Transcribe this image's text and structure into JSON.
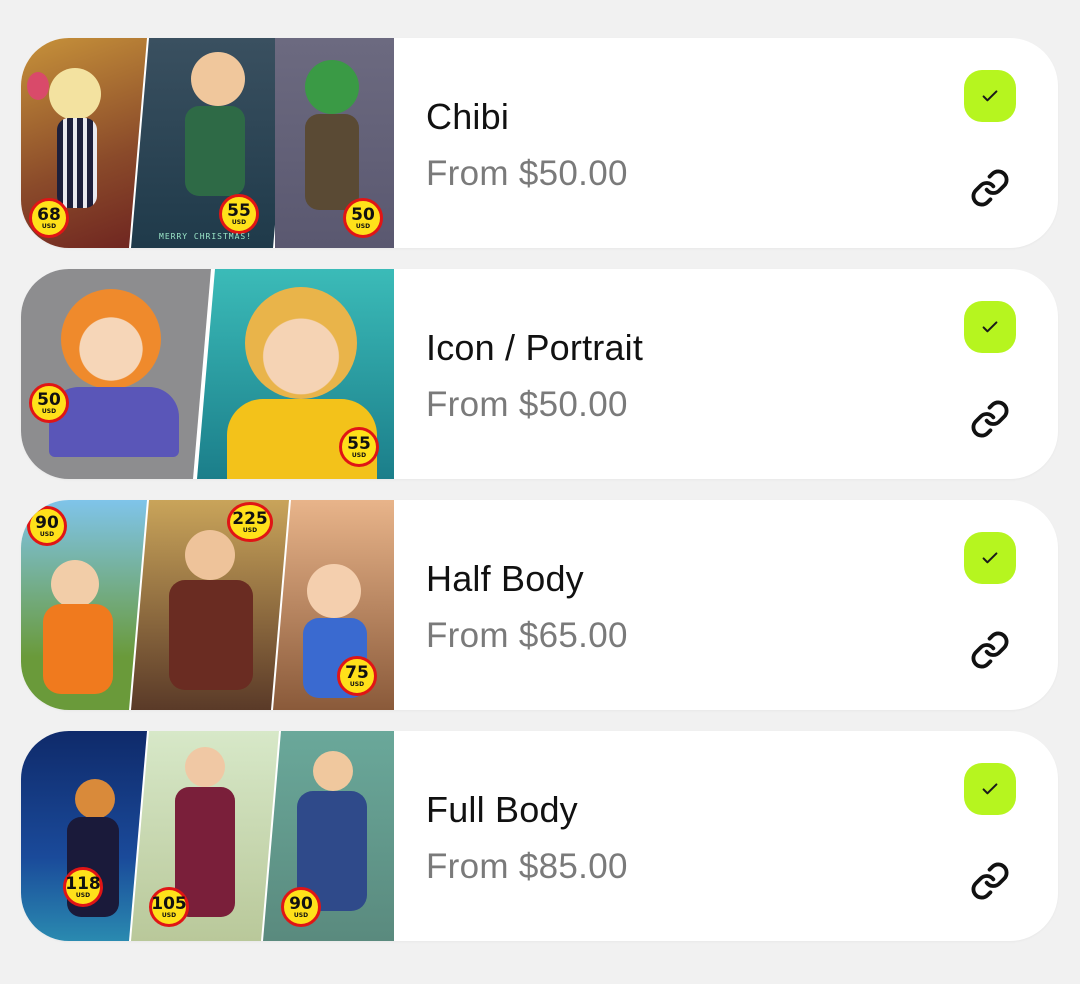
{
  "commissions": [
    {
      "title": "Chibi",
      "price": "From $50.00",
      "badges": [
        {
          "value": "68",
          "unit": "USD"
        },
        {
          "value": "55",
          "unit": "USD"
        },
        {
          "value": "50",
          "unit": "USD"
        }
      ],
      "caption": "MERRY CHRISTMAS!",
      "checked": true,
      "icons": {
        "check": "check-icon",
        "link": "link-icon"
      }
    },
    {
      "title": "Icon / Portrait",
      "price": "From $50.00",
      "badges": [
        {
          "value": "50",
          "unit": "USD"
        },
        {
          "value": "55",
          "unit": "USD"
        }
      ],
      "checked": true,
      "icons": {
        "check": "check-icon",
        "link": "link-icon"
      }
    },
    {
      "title": "Half Body",
      "price": "From $65.00",
      "badges": [
        {
          "value": "90",
          "unit": "USD"
        },
        {
          "value": "225",
          "unit": "USD"
        },
        {
          "value": "75",
          "unit": "USD"
        }
      ],
      "checked": true,
      "icons": {
        "check": "check-icon",
        "link": "link-icon"
      }
    },
    {
      "title": "Full Body",
      "price": "From $85.00",
      "badges": [
        {
          "value": "118",
          "unit": "USD"
        },
        {
          "value": "105",
          "unit": "USD"
        },
        {
          "value": "90",
          "unit": "USD"
        }
      ],
      "checked": true,
      "icons": {
        "check": "check-icon",
        "link": "link-icon"
      }
    }
  ],
  "colors": {
    "background": "#f1f1f1",
    "card": "#ffffff",
    "check_button": "#b6f51f",
    "badge_fill": "#ffe11a",
    "badge_ring": "#e01515",
    "title_text": "#111111",
    "price_text": "#7a7a7a"
  }
}
